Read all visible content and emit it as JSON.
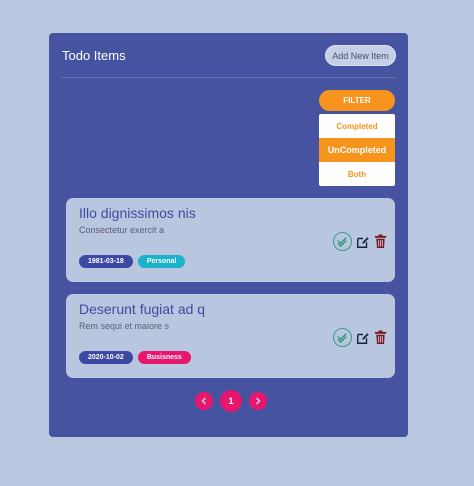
{
  "header": {
    "title": "Todo Items",
    "add_label": "Add New Item"
  },
  "filter": {
    "label": "FILTER",
    "options": [
      "Completed",
      "UnCompleted",
      "Both"
    ],
    "selected": "UnCompleted"
  },
  "todos": [
    {
      "title": "Illo dignissimos nis",
      "description": "Consectetur exercit a",
      "date": "1981-03-18",
      "category": "Personal",
      "category_color": "#1ab3c9"
    },
    {
      "title": "Deserunt fugiat ad q",
      "description": "Rem sequi et maiore s",
      "date": "2020-10-02",
      "category": "Busisness",
      "category_color": "#e8166c"
    }
  ],
  "pagination": {
    "current": "1",
    "prev_icon": "chevron-left-icon",
    "next_icon": "chevron-right-icon"
  },
  "colors": {
    "panel": "#4553a0",
    "accent": "#f7941d",
    "pager": "#e8166c",
    "complete_icon": "#3b9b7d",
    "edit_icon": "#1c2140",
    "delete_icon": "#7a1620"
  }
}
